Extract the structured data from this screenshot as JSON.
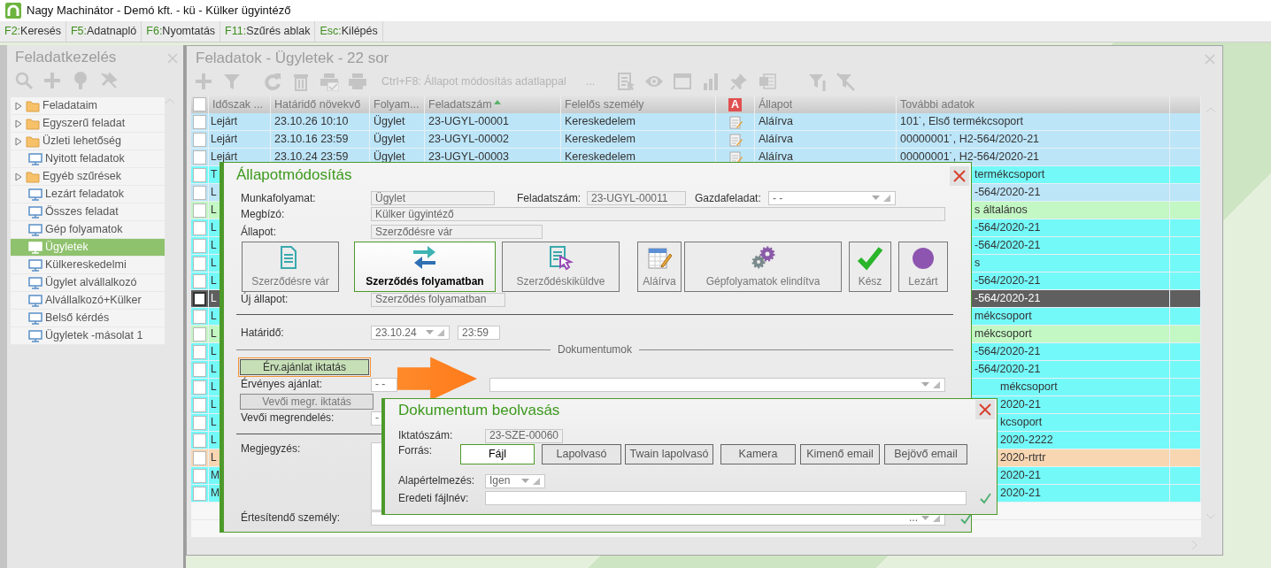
{
  "window": {
    "title": "Nagy Machinátor - Demó kft. - kü - Külker ügyintéző"
  },
  "shortcuts": [
    {
      "key": "F2:",
      "label": "Keresés"
    },
    {
      "key": "F5:",
      "label": "Adatnapló"
    },
    {
      "key": "F6:",
      "label": "Nyomtatás"
    },
    {
      "key": "F11:",
      "label": "Szűrés ablak"
    },
    {
      "key": "Esc:",
      "label": "Kilépés"
    }
  ],
  "sidebar": {
    "title": "Feladatkezelés",
    "items": [
      {
        "label": "Feladataim",
        "kind": "folder",
        "selected": false
      },
      {
        "label": "Egyszerű feladat",
        "kind": "folder",
        "selected": false
      },
      {
        "label": "Üzleti lehetőség",
        "kind": "folder",
        "selected": false
      },
      {
        "label": "Nyitott feladatok",
        "kind": "view",
        "selected": false
      },
      {
        "label": "Egyéb szűrések",
        "kind": "folder",
        "selected": false
      },
      {
        "label": "Lezárt feladatok",
        "kind": "view",
        "selected": false
      },
      {
        "label": "Összes feladat",
        "kind": "view",
        "selected": false
      },
      {
        "label": "Gép folyamatok",
        "kind": "view",
        "selected": false
      },
      {
        "label": "Ügyletek",
        "kind": "view",
        "selected": true
      },
      {
        "label": "Külkereskedelmi",
        "kind": "view",
        "selected": false
      },
      {
        "label": "Ügylet alvállalkozó",
        "kind": "view",
        "selected": false
      },
      {
        "label": "Alvállalkozó+Külker",
        "kind": "view",
        "selected": false
      },
      {
        "label": "Belső kérdés",
        "kind": "view",
        "selected": false
      },
      {
        "label": "Ügyletek -másolat 1",
        "kind": "view",
        "selected": false
      }
    ]
  },
  "panel": {
    "title": "Feladatok - Ügyletek - 22 sor",
    "hint": "Ctrl+F8: Állapot módosítás adatlappal",
    "more": "..."
  },
  "table": {
    "all_checked": false,
    "columns": [
      {
        "label": "Időszak ...",
        "kind": "text",
        "sorted": false
      },
      {
        "label": "Határidő növekvő",
        "kind": "text",
        "sorted": false
      },
      {
        "label": "Folyam...",
        "kind": "text",
        "sorted": false
      },
      {
        "label": "Feladatszám",
        "kind": "text",
        "sorted": true
      },
      {
        "label": "Felelős személy",
        "kind": "text",
        "sorted": false
      },
      {
        "label": "A",
        "kind": "badge",
        "sorted": false
      },
      {
        "label": "Állapot",
        "kind": "text",
        "sorted": false
      },
      {
        "label": "További adatok",
        "kind": "text",
        "sorted": false
      }
    ],
    "rows": [
      {
        "checked": false,
        "selected": false,
        "color": "#bde5f8",
        "period": "Lejárt",
        "deadline": "23.10.26 10:10",
        "flow": "Ügylet",
        "number": "23-UGYL-00001",
        "owner": "Kereskedelem",
        "status": "Aláírva",
        "more": "101˙, Első termékcsoport"
      },
      {
        "checked": false,
        "selected": false,
        "color": "#bde5f8",
        "period": "Lejárt",
        "deadline": "23.10.16 23:59",
        "flow": "Ügylet",
        "number": "23-UGYL-00002",
        "owner": "Kereskedelem",
        "status": "Aláírva",
        "more": "00000001˙, H2-564/2020-21"
      },
      {
        "checked": false,
        "selected": false,
        "color": "#bde5f8",
        "period": "Lejárt",
        "deadline": "23.10.24 23:59",
        "flow": "Ügylet",
        "number": "23-UGYL-00003",
        "owner": "Kereskedelem",
        "status": "Aláírva",
        "more": "00000001˙, H2-564/2020-21"
      },
      {
        "checked": false,
        "selected": false,
        "color": "#74f9f9",
        "period": "T",
        "more": "termékcsoport"
      },
      {
        "checked": false,
        "selected": false,
        "color": "#bde5f8",
        "period": "L",
        "more": "-564/2020-21"
      },
      {
        "checked": false,
        "selected": false,
        "color": "#c3f7c3",
        "period": "L",
        "more": "s általános"
      },
      {
        "checked": false,
        "selected": false,
        "color": "#74f9f9",
        "period": "L",
        "more": "-564/2020-21"
      },
      {
        "checked": false,
        "selected": false,
        "color": "#74f9f9",
        "period": "L",
        "more": "-564/2020-21"
      },
      {
        "checked": false,
        "selected": false,
        "color": "#74f9f9",
        "period": "L",
        "more": "s"
      },
      {
        "checked": false,
        "selected": false,
        "color": "#74f9f9",
        "period": "L",
        "more": "-564/2020-21"
      },
      {
        "checked": false,
        "selected": true,
        "period": "L",
        "more": "-564/2020-21"
      },
      {
        "checked": false,
        "selected": false,
        "color": "#74f9f9",
        "period": "L",
        "more": "mékcsoport"
      },
      {
        "checked": false,
        "selected": false,
        "color": "#c3f7c3",
        "period": "L",
        "more": "mékcsoport"
      },
      {
        "checked": false,
        "selected": false,
        "color": "#74f9f9",
        "period": "L",
        "more": "-564/2020-21"
      },
      {
        "checked": false,
        "selected": false,
        "color": "#74f9f9",
        "period": "L",
        "more": "-564/2020-21"
      },
      {
        "checked": false,
        "selected": false,
        "color": "#74f9f9",
        "period": "L",
        "more": "mékcsoport"
      },
      {
        "checked": false,
        "selected": false,
        "color": "#74f9f9",
        "period": "L",
        "more": "2020-21"
      },
      {
        "checked": false,
        "selected": false,
        "color": "#74f9f9",
        "period": "L",
        "more": "kcsoport"
      },
      {
        "checked": false,
        "selected": false,
        "color": "#74f9f9",
        "period": "L",
        "more": "2020-2222"
      },
      {
        "checked": false,
        "selected": false,
        "color": "#f8d6b2",
        "period": "L",
        "more": "2020-rtrtr"
      },
      {
        "checked": false,
        "selected": false,
        "color": "#74f9f9",
        "period": "M",
        "more": "2020-21"
      },
      {
        "checked": false,
        "selected": false,
        "color": "#74f9f9",
        "period": "M",
        "more": "2020-21"
      }
    ]
  },
  "status_dialog": {
    "title": "Állapotmódosítás",
    "workflow_label": "Munkafolyamat:",
    "workflow": "Ügylet",
    "task_number_label": "Feladatszám:",
    "task_number": "23-UGYL-00011",
    "parent_label": "Gazdafeladat:",
    "parent": "-   -",
    "client_label": "Megbízó:",
    "client": "Külker ügyintéző",
    "state_label": "Állapot:",
    "state": "Szerződésre vár",
    "states": [
      {
        "label": "Szerződésre vár",
        "selected": false
      },
      {
        "label": "Szerződés folyamatban",
        "selected": true
      },
      {
        "label": "Szerződéskiküldve",
        "selected": false
      },
      {
        "label": "Aláírva",
        "selected": false
      },
      {
        "label": "Gépfolyamatok elindítva",
        "selected": false
      },
      {
        "label": "Kész",
        "selected": false
      },
      {
        "label": "Lezárt",
        "selected": false
      }
    ],
    "new_state_label": "Új állapot:",
    "new_state": "Szerződés folyamatban",
    "deadline_label": "Határidő:",
    "deadline_date": "23.10.24",
    "deadline_time": "23:59",
    "section": "Dokumentumok",
    "offer_button": "Érv.ajánlat iktatás",
    "offer_label": "Érvényes ajánlat:",
    "offer_value": "-   -",
    "order_button": "Vevői megr. iktatás",
    "order_label": "Vevői megrendelés:",
    "order_value": "-",
    "note_label": "Megjegyzés:",
    "notify_label": "Értesítendő személy:",
    "notify_more": "..."
  },
  "scan_dialog": {
    "title": "Dokumentum beolvasás",
    "reg_label": "Iktatószám:",
    "reg": "23-SZE-00060",
    "source_label": "Forrás:",
    "sources": [
      {
        "label": "Fájl",
        "selected": true
      },
      {
        "label": "Lapolvasó",
        "selected": false
      },
      {
        "label": "Twain lapolvasó",
        "selected": false
      },
      {
        "label": "Kamera",
        "selected": false
      },
      {
        "label": "Kimenő email",
        "selected": false
      },
      {
        "label": "Bejövő email",
        "selected": false
      }
    ],
    "default_label": "Alapértelmezés:",
    "default": "Igen",
    "filename_label": "Eredeti fájlnév:"
  }
}
